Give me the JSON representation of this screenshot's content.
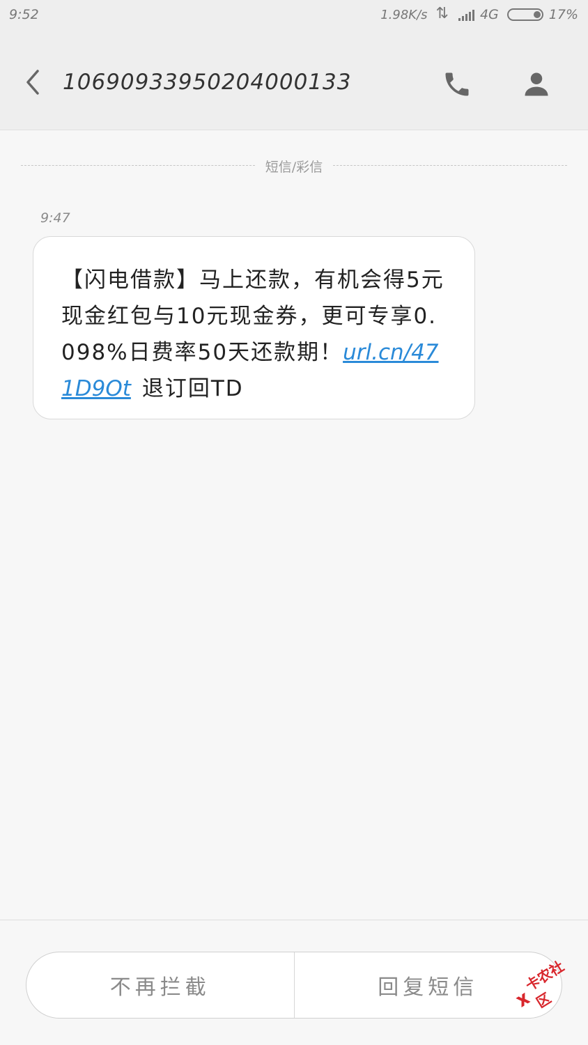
{
  "status_bar": {
    "time": "9:52",
    "net_speed": "1.98K/s",
    "network_type": "4G",
    "battery": "17%",
    "icons": [
      "data-arrows-icon",
      "signal-icon",
      "battery-icon"
    ]
  },
  "header": {
    "title": "10690933950204000133",
    "icons": [
      "back-icon",
      "call-icon",
      "contact-icon"
    ]
  },
  "conversation": {
    "divider_label": "短信/彩信",
    "message": {
      "time": "9:47",
      "text": "【闪电借款】马上还款，有机会得5元现金红包与10元现金券，更可专享0.098%日费率50天还款期！",
      "link": "url.cn/471D9Ot",
      "tail": "退订回TD"
    }
  },
  "actions": {
    "left_label": "不再拦截",
    "right_label": "回复短信"
  },
  "watermark": {
    "text": "卡农社区",
    "color": "#d8262c"
  },
  "colors": {
    "link": "#2a8ad8",
    "background": "#f7f7f7",
    "header": "#eeeeee"
  }
}
